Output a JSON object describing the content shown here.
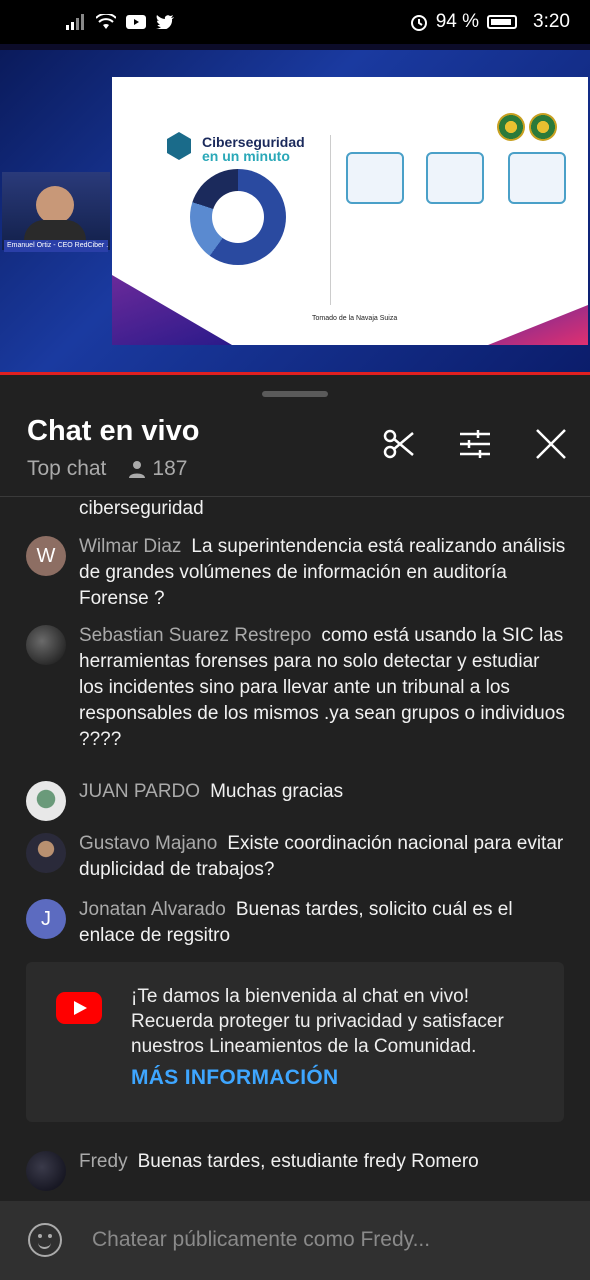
{
  "status_bar": {
    "battery": "94 %",
    "time": "3:20"
  },
  "video": {
    "slide_title_line1": "Ciberseguridad",
    "slide_title_line2": "en un minuto",
    "slide_footer": "Tomado de la Navaja Suiza",
    "presenter_caption": "Emanuel Ortiz - CEO RedCiber ..."
  },
  "chat": {
    "title": "Chat en vivo",
    "mode": "Top chat",
    "viewer_count": "187",
    "icons": [
      "scissors-icon",
      "tune-icon",
      "close-icon"
    ],
    "messages": [
      {
        "author": "",
        "text": "ciberseguridad",
        "avatar": ""
      },
      {
        "author": "Wilmar Diaz",
        "text": "La superintendencia está realizando análisis de grandes volúmenes de información en auditoría Forense ?",
        "avatar": "W"
      },
      {
        "author": "Sebastian Suarez Restrepo",
        "text": "como está usando la SIC las herramientas forenses para no solo detectar y estudiar los incidentes sino para llevar ante un tribunal a los responsables de los mismos .ya sean grupos o individuos ????",
        "avatar": ""
      },
      {
        "author": "JUAN PARDO",
        "text": "Muchas gracias",
        "avatar": ""
      },
      {
        "author": "Gustavo Majano",
        "text": "Existe coordinación nacional para evitar duplicidad de trabajos?",
        "avatar": ""
      },
      {
        "author": "Jonatan Alvarado",
        "text": "Buenas tardes, solicito cuál es el enlace de regsitro",
        "avatar": "J"
      },
      {
        "author": "Fredy",
        "text": "Buenas tardes, estudiante fredy Romero",
        "avatar": ""
      }
    ],
    "welcome": {
      "text": "¡Te damos la bienvenida al chat en vivo! Recuerda proteger tu privacidad y satisfacer nuestros Lineamientos de la Comunidad.",
      "link": "MÁS INFORMACIÓN"
    },
    "input_placeholder": "Chatear públicamente como Fredy..."
  }
}
